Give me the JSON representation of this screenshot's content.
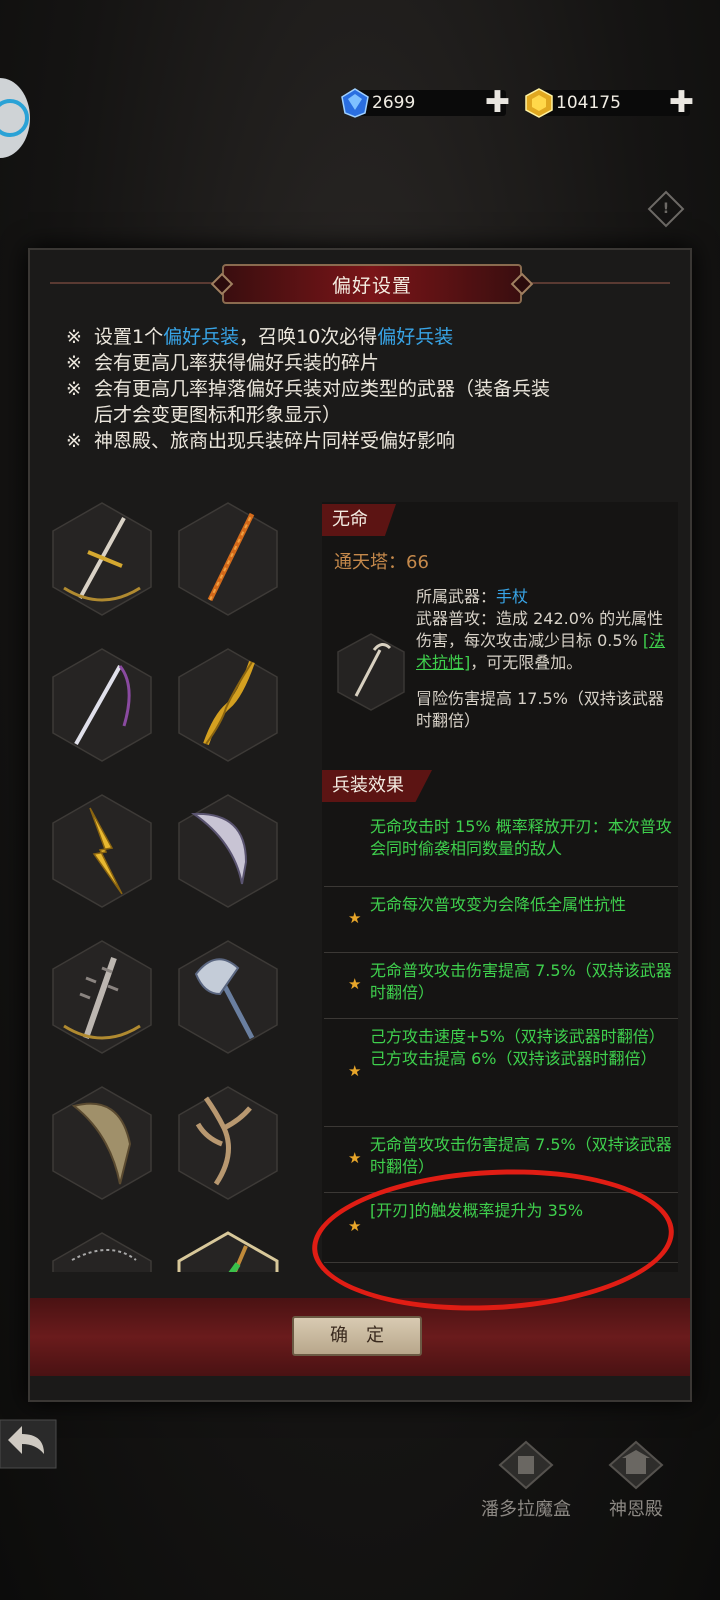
{
  "currency": {
    "gems": "2699",
    "gold": "104175",
    "plus": "✚"
  },
  "panel": {
    "title": "偏好设置",
    "notes": [
      {
        "mark": "※",
        "parts": [
          "设置1个",
          "偏好兵装",
          "，召唤10次必得",
          "偏好兵装"
        ]
      },
      {
        "mark": "※",
        "text": "会有更高几率获得偏好兵装的碎片"
      },
      {
        "mark": "※",
        "text": "会有更高几率掉落偏好兵装对应类型的武器（装备兵装"
      },
      {
        "mark": "",
        "text": "后才会变更图标和形象显示）"
      },
      {
        "mark": "※",
        "text": "神恩殿、旅商出现兵装碎片同样受偏好影响"
      }
    ],
    "weapons": [
      "golden-sword-icon",
      "spear-icon",
      "katana-icon",
      "golden-twisted-staff-icon",
      "lightning-bolt-icon",
      "curved-blade-icon",
      "spiked-mace-icon",
      "battle-axe-icon",
      "horn-blade-icon",
      "branch-staff-icon",
      "chain-weapon-icon",
      "scythe-icon"
    ],
    "detail": {
      "name": "无命",
      "tower_label": "通天塔：66",
      "weapon_type_label": "所属武器：",
      "weapon_type": "手杖",
      "attack_text_1": "武器普攻：造成 242.0% 的光属性伤害，每次攻击减少目标 0.5% ",
      "attack_link": "[法术抗性]",
      "attack_text_2": "，可无限叠加。",
      "adventure_bonus": "冒险伤害提高 17.5%（双持该武器时翻倍）",
      "effects_title": "兵装效果",
      "effects": [
        {
          "star": "",
          "text": "无命攻击时 15% 概率释放开刃：本次普攻会同时偷袭相同数量的敌人"
        },
        {
          "star": "★",
          "text": "无命每次普攻变为会降低全属性抗性"
        },
        {
          "star": "★",
          "text": "无命普攻攻击伤害提高 7.5%（双持该武器时翻倍）"
        },
        {
          "star": "★",
          "text": "己方攻击速度+5%（双持该武器时翻倍）\n己方攻击提高 6%（双持该武器时翻倍）"
        },
        {
          "star": "★",
          "text": "无命普攻攻击伤害提高 7.5%（双持该武器时翻倍）"
        },
        {
          "star": "★",
          "text": "[开刃]的触发概率提升为 35%"
        }
      ]
    },
    "confirm_label": "确定"
  },
  "bottom": {
    "pandora_label": "潘多拉魔盒",
    "temple_label": "神恩殿"
  },
  "colors": {
    "accent_blue": "#38a4e6",
    "effect_green": "#3fd04d",
    "banner_red": "#7a1518",
    "star_gold": "#e8a62a",
    "annotation_red": "#e01d14"
  }
}
